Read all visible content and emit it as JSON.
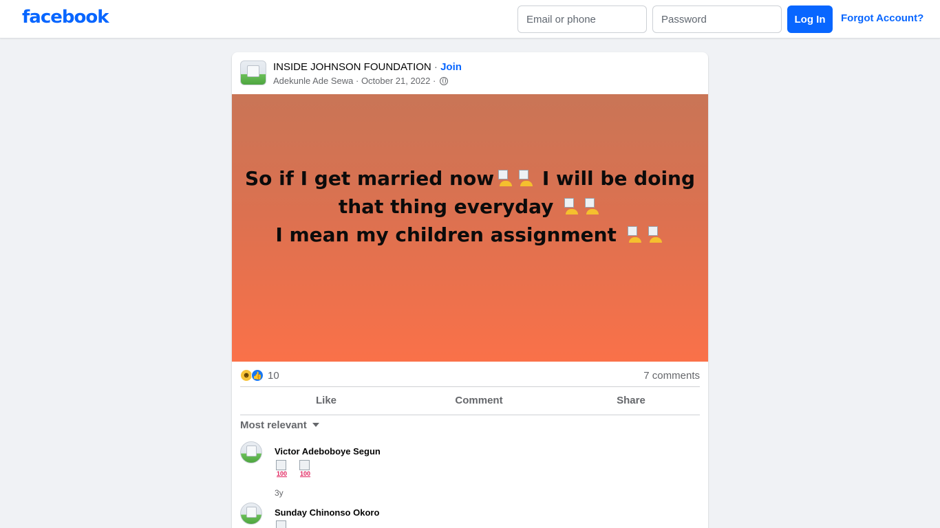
{
  "topbar": {
    "logo": "facebook",
    "email_placeholder": "Email or phone",
    "password_placeholder": "Password",
    "login_label": "Log In",
    "forgot_label": "Forgot Account?"
  },
  "post": {
    "group_name": "INSIDE JOHNSON FOUNDATION",
    "separator": " · ",
    "join_label": "Join",
    "author": "Adekunle Ade Sewa",
    "date": "October 21, 2022",
    "audience_icon": "globe-icon",
    "text_lines": [
      "So if I get married now",
      " I will be doing",
      "that thing everyday ",
      "I mean my children assignment "
    ],
    "background_colors": [
      "#c97556",
      "#fa7149"
    ],
    "reaction_icons": [
      "haha-icon",
      "like-icon"
    ],
    "reaction_count": "10",
    "comment_count": "7 comments"
  },
  "actions": {
    "like": "Like",
    "comment": "Comment",
    "share": "Share"
  },
  "comments_section": {
    "sort_label": "Most relevant",
    "comments": [
      {
        "author": "Victor Adeboboye Segun",
        "emoji": [
          "hundred-points-icon",
          "hundred-points-icon"
        ],
        "time": "3y"
      },
      {
        "author": "Sunday Chinonso Okoro",
        "emoji": [
          "hundred-points-icon"
        ],
        "time": ""
      }
    ]
  },
  "colors": {
    "brand": "#0866ff",
    "page_bg": "#f0f2f5",
    "muted_text": "#65676b"
  }
}
